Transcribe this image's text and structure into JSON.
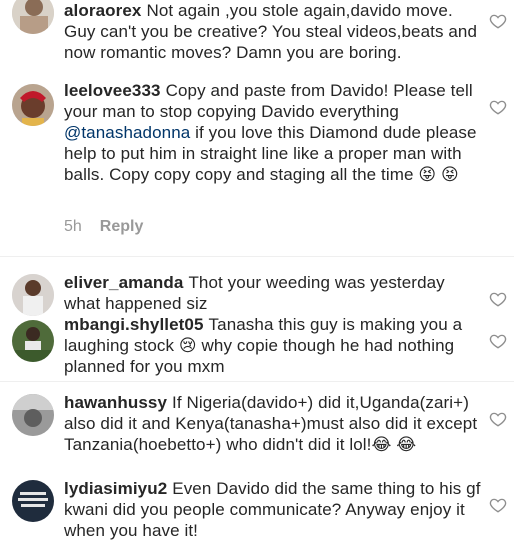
{
  "comments": [
    {
      "username": "aloraorex",
      "text": "Not again ,you stole again,davido move. Guy can't you be creative? You steal videos,beats and now romantic moves? Damn you are boring."
    },
    {
      "username": "leelovee333",
      "text_before": "Copy and paste from Davido! Please tell your man to stop copying Davido everything ",
      "mention": "@tanashadonna",
      "text_after": " if you love this Diamond dude please help to put him in straight line like a proper man with balls. Copy copy copy and staging all the time ",
      "emojis": "😝 😝",
      "time": "5h",
      "reply_label": "Reply"
    },
    {
      "username": "eliver_amanda",
      "text": "Thot your weeding was yesterday what happened siz"
    },
    {
      "username": "mbangi.shyllet05",
      "text_before": "Tanasha this guy is making you a laughing stock ",
      "emoji": "😢",
      "text_after": " why copie though he had nothing planned for you mxm"
    },
    {
      "username": "hawanhussy",
      "text": "If Nigeria(davido+) did it,Uganda(zari+) also did it and Kenya(tanasha+)must also did it except Tanzania(hoebetto+) who didn't did it lol!",
      "emojis": "😂 😂"
    },
    {
      "username": "lydiasimiyu2",
      "text": "Even Davido did the same thing to his gf kwani did you people communicate? Anyway enjoy it when you have it!"
    }
  ],
  "icons": {
    "like": "heart-outline-icon"
  },
  "colors": {
    "text": "#262626",
    "muted": "#999999",
    "mention": "#003569"
  }
}
